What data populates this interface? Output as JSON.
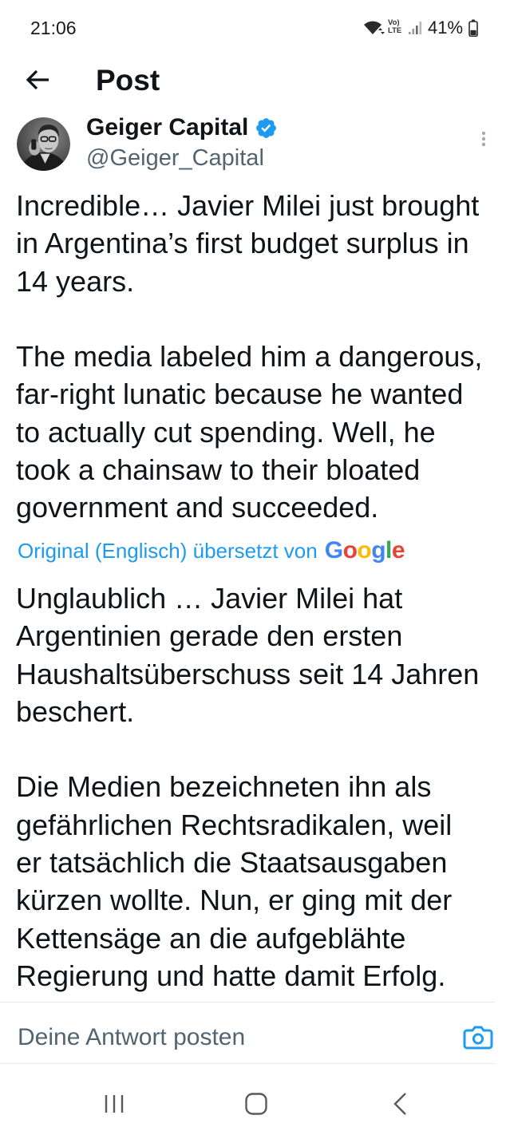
{
  "status_bar": {
    "time": "21:06",
    "volte_top": "Vo)",
    "volte_bottom": "LTE",
    "battery": "41%",
    "battery_level": 0.41,
    "icons": [
      "wifi-icon",
      "signal-icon",
      "battery-icon"
    ]
  },
  "header": {
    "title": "Post",
    "back_icon": "back-arrow-icon"
  },
  "post": {
    "author": {
      "name": "Geiger Capital",
      "handle": "@Geiger_Capital",
      "verified": true
    },
    "text_lines": [
      [
        "Incredible… Javier Milei just brought",
        "in Argentina’s first budget surplus in",
        "14 years."
      ],
      [
        "The media labeled him a dangerous,",
        "far-right lunatic because he wanted",
        "to actually cut spending. Well, he",
        "took a chainsaw to their bloated",
        "government and succeeded."
      ]
    ],
    "translation": {
      "label": "Original (Englisch) übersetzt von",
      "provider": "Google",
      "text_lines": [
        [
          "Unglaublich … Javier Milei hat",
          "Argentinien gerade den ersten",
          "Haushaltsüberschuss seit 14 Jahren",
          "beschert."
        ],
        [
          "Die Medien bezeichneten ihn als",
          "gefährlichen Rechtsradikalen, weil",
          "er tatsächlich die Staatsausgaben",
          "kürzen wollte. Nun, er ging mit der",
          "Kettensäge an die aufgeblähte",
          "Regierung und hatte damit Erfolg."
        ]
      ]
    }
  },
  "reply": {
    "placeholder": "Deine Antwort posten",
    "media_icon": "camera-icon"
  },
  "nav_bar": {
    "icons": [
      "recent-apps-icon",
      "home-icon",
      "back-icon"
    ]
  },
  "colors": {
    "text": "#0f1419",
    "secondary_text": "#536471",
    "accent": "#1d9bf0",
    "divider": "#e6eaec",
    "google_letters": [
      "#4285f4",
      "#ea4335",
      "#fbbc05",
      "#4285f4",
      "#34a853",
      "#ea4335"
    ]
  }
}
